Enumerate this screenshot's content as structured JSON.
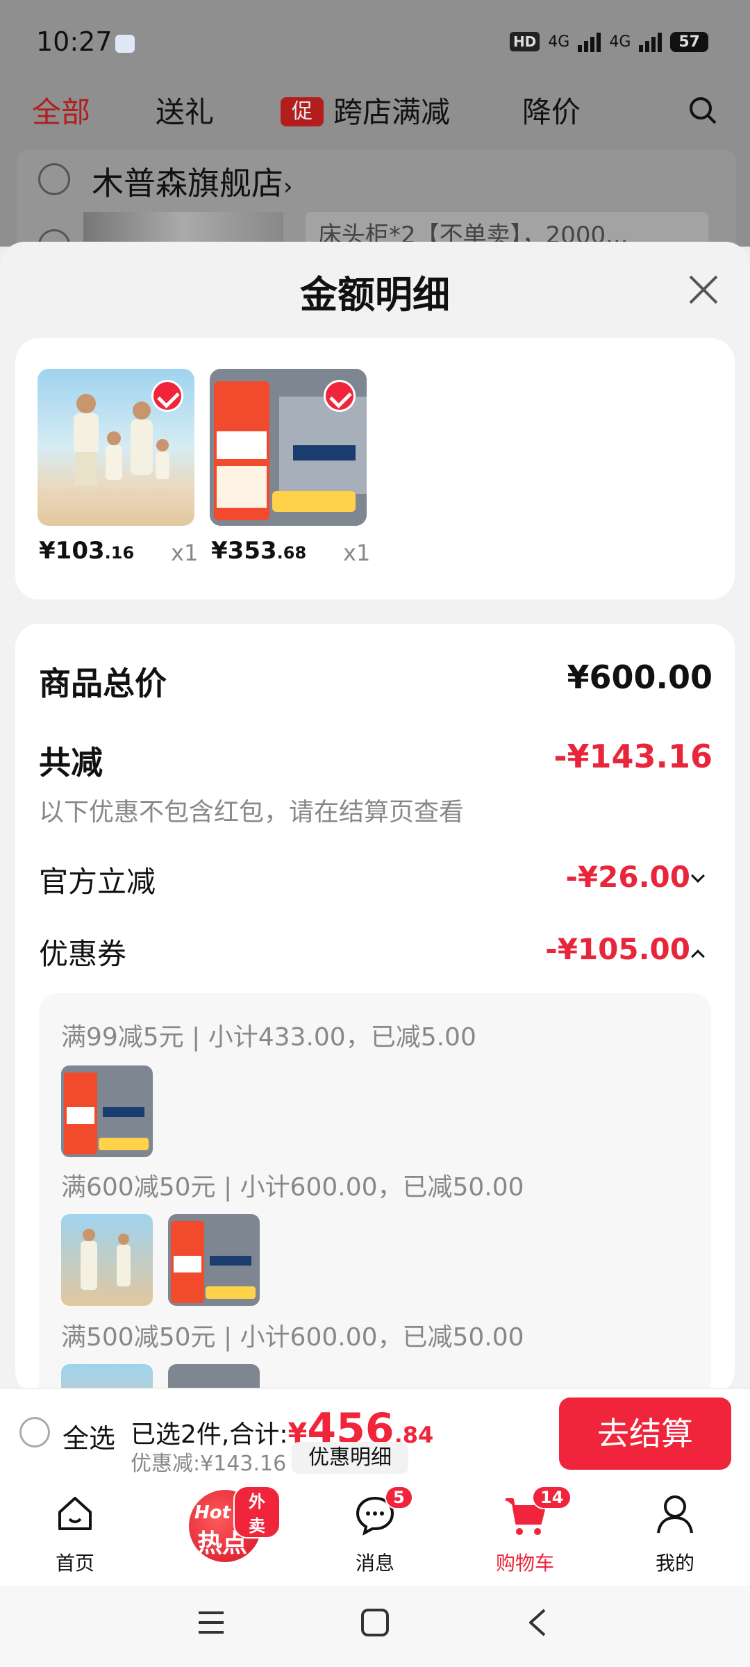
{
  "status_bar": {
    "time": "10:27",
    "network_hd": "HD",
    "network_4g_1": "4G",
    "network_4g_2": "4G",
    "battery": "57"
  },
  "background_page": {
    "tabs": [
      "全部",
      "送礼",
      "跨店满减",
      "降价"
    ],
    "promo_badge": "促",
    "store_name": "木普森旗舰店",
    "store_chevron": "›",
    "item_spec": "床头柜*2【不单卖】，2000..."
  },
  "sheet": {
    "title": "金额明细",
    "products": [
      {
        "price_int": "¥103",
        "price_dec": ".16",
        "qty": "x1"
      },
      {
        "price_int": "¥353",
        "price_dec": ".68",
        "qty": "x1"
      }
    ],
    "summary": {
      "goods_total_label": "商品总价",
      "goods_total_value": "¥600.00",
      "total_discount_label": "共减",
      "total_discount_value": "-¥143.16",
      "note": "以下优惠不包含红包，请在结算页查看",
      "official_label": "官方立减",
      "official_value": "-¥26.00",
      "coupon_label": "优惠券",
      "coupon_value": "-¥105.00"
    },
    "coupons": [
      {
        "text": "满99减5元 | 小计433.00，已减5.00"
      },
      {
        "text": "满600减50元 | 小计600.00，已减50.00"
      },
      {
        "text": "满500减50元 | 小计600.00，已减50.00"
      }
    ]
  },
  "checkout_bar": {
    "select_all": "全选",
    "selected_text": "已选2件,合计:",
    "currency": "¥",
    "total_int": "456",
    "total_dec": ".84",
    "discount_text": "优惠减:¥143.16",
    "detail_button": "优惠明细",
    "checkout_button": "去结算"
  },
  "tab_bar": {
    "items": [
      {
        "label": "首页"
      },
      {
        "label": "热点",
        "badge": "外卖",
        "hot": "Hot"
      },
      {
        "label": "消息",
        "badge": "5"
      },
      {
        "label": "购物车",
        "badge": "14"
      },
      {
        "label": "我的"
      }
    ]
  },
  "colors": {
    "accent": "#f0243a",
    "discount_red": "#e8263b"
  }
}
